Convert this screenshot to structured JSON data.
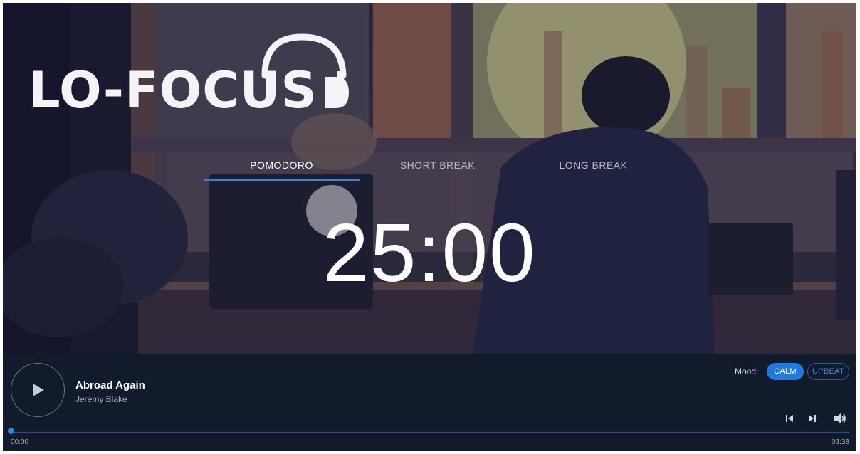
{
  "brand": {
    "name": "LO-FOCUS",
    "logo_icon": "headphones-icon"
  },
  "tabs": [
    {
      "label": "POMODORO",
      "active": true
    },
    {
      "label": "SHORT BREAK",
      "active": false
    },
    {
      "label": "LONG BREAK",
      "active": false
    }
  ],
  "timer": {
    "display": "25:00"
  },
  "player": {
    "play_icon": "play-icon",
    "track_title": "Abroad Again",
    "track_artist": "Jeremy Blake",
    "mood_label": "Mood:",
    "moods": [
      {
        "label": "CALM",
        "selected": true
      },
      {
        "label": "UPBEAT",
        "selected": false
      }
    ],
    "controls": [
      "skip-previous-icon",
      "skip-next-icon",
      "volume-icon"
    ],
    "progress_fraction": 0,
    "current_time": "00:00",
    "duration": "03:38"
  },
  "colors": {
    "accent": "#2f86e0",
    "player_bg": "#111b2b",
    "text_primary": "#ffffff"
  }
}
